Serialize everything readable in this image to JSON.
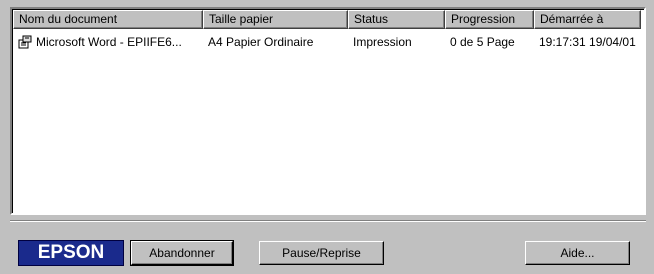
{
  "columns": [
    "Nom du document",
    "Taille papier",
    "Status",
    "Progression",
    "Démarrée à"
  ],
  "jobs": [
    {
      "icon": "document-icon",
      "name": "Microsoft Word - EPIIFE6...",
      "paper": "A4 Papier Ordinaire",
      "status": "Impression",
      "progress": "0 de 5 Page",
      "started": "19:17:31 19/04/01"
    }
  ],
  "logo": {
    "text": "EPSON",
    "color": "#1a2a8c"
  },
  "buttons": {
    "abandon": "Abandonner",
    "pause": "Pause/Reprise",
    "help": "Aide..."
  }
}
